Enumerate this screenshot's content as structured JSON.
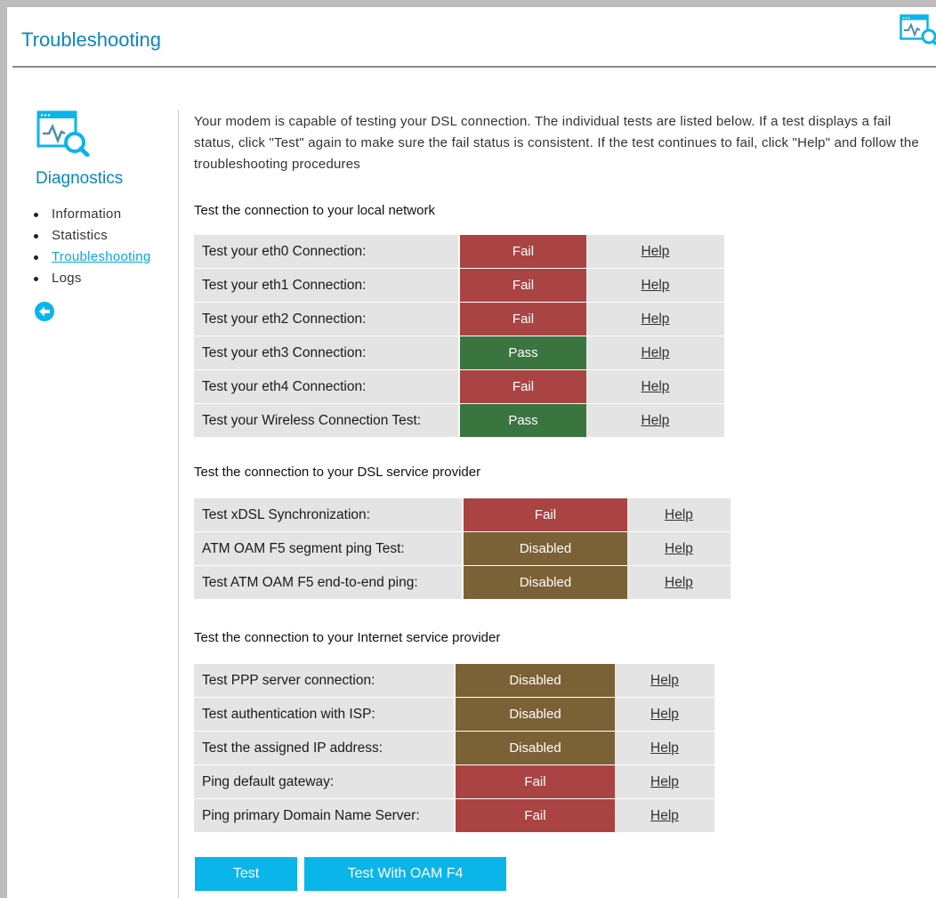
{
  "page": {
    "title": "Troubleshooting",
    "top_icon": "diagnostics-monitor-icon"
  },
  "colors": {
    "accent": "#0a86bf",
    "button": "#0ab5ea",
    "fail": "#a94442",
    "pass": "#3a7540",
    "disabled": "#7b6136",
    "row_bg": "#e4e4e4"
  },
  "sidebar": {
    "icon": "diagnostics-magnifier-icon",
    "heading": "Diagnostics",
    "items": [
      {
        "label": "Information",
        "active": false
      },
      {
        "label": "Statistics",
        "active": false
      },
      {
        "label": "Troubleshooting",
        "active": true
      },
      {
        "label": "Logs",
        "active": false
      }
    ],
    "back_icon": "back-arrow-icon"
  },
  "intro": "Your modem is capable of testing your DSL connection. The individual tests are listed below. If a test displays a fail status, click \"Test\" again to make sure the fail status is consistent. If the test continues to fail, click \"Help\" and follow the troubleshooting procedures",
  "sections": [
    {
      "heading": "Test the connection to your local network",
      "rows": [
        {
          "label": "Test your eth0 Connection:",
          "status": "Fail",
          "help": "Help"
        },
        {
          "label": "Test your eth1 Connection:",
          "status": "Fail",
          "help": "Help"
        },
        {
          "label": "Test your eth2 Connection:",
          "status": "Fail",
          "help": "Help"
        },
        {
          "label": "Test your eth3 Connection:",
          "status": "Pass",
          "help": "Help"
        },
        {
          "label": "Test your eth4 Connection:",
          "status": "Fail",
          "help": "Help"
        },
        {
          "label": "Test your Wireless Connection Test:",
          "status": "Pass",
          "help": "Help"
        }
      ]
    },
    {
      "heading": "Test the connection to your DSL service provider",
      "rows": [
        {
          "label": "Test xDSL Synchronization:",
          "status": "Fail",
          "help": "Help"
        },
        {
          "label": "ATM OAM F5 segment ping Test:",
          "status": "Disabled",
          "help": "Help"
        },
        {
          "label": "Test ATM OAM F5 end-to-end ping:",
          "status": "Disabled",
          "help": "Help"
        }
      ]
    },
    {
      "heading": "Test the connection to your Internet service provider",
      "rows": [
        {
          "label": "Test PPP server connection:",
          "status": "Disabled",
          "help": "Help"
        },
        {
          "label": "Test authentication with ISP:",
          "status": "Disabled",
          "help": "Help"
        },
        {
          "label": "Test the assigned IP address:",
          "status": "Disabled",
          "help": "Help"
        },
        {
          "label": "Ping default gateway:",
          "status": "Fail",
          "help": "Help"
        },
        {
          "label": "Ping primary Domain Name Server:",
          "status": "Fail",
          "help": "Help"
        }
      ]
    }
  ],
  "buttons": {
    "test": "Test",
    "test_oam_f4": "Test With OAM F4"
  }
}
